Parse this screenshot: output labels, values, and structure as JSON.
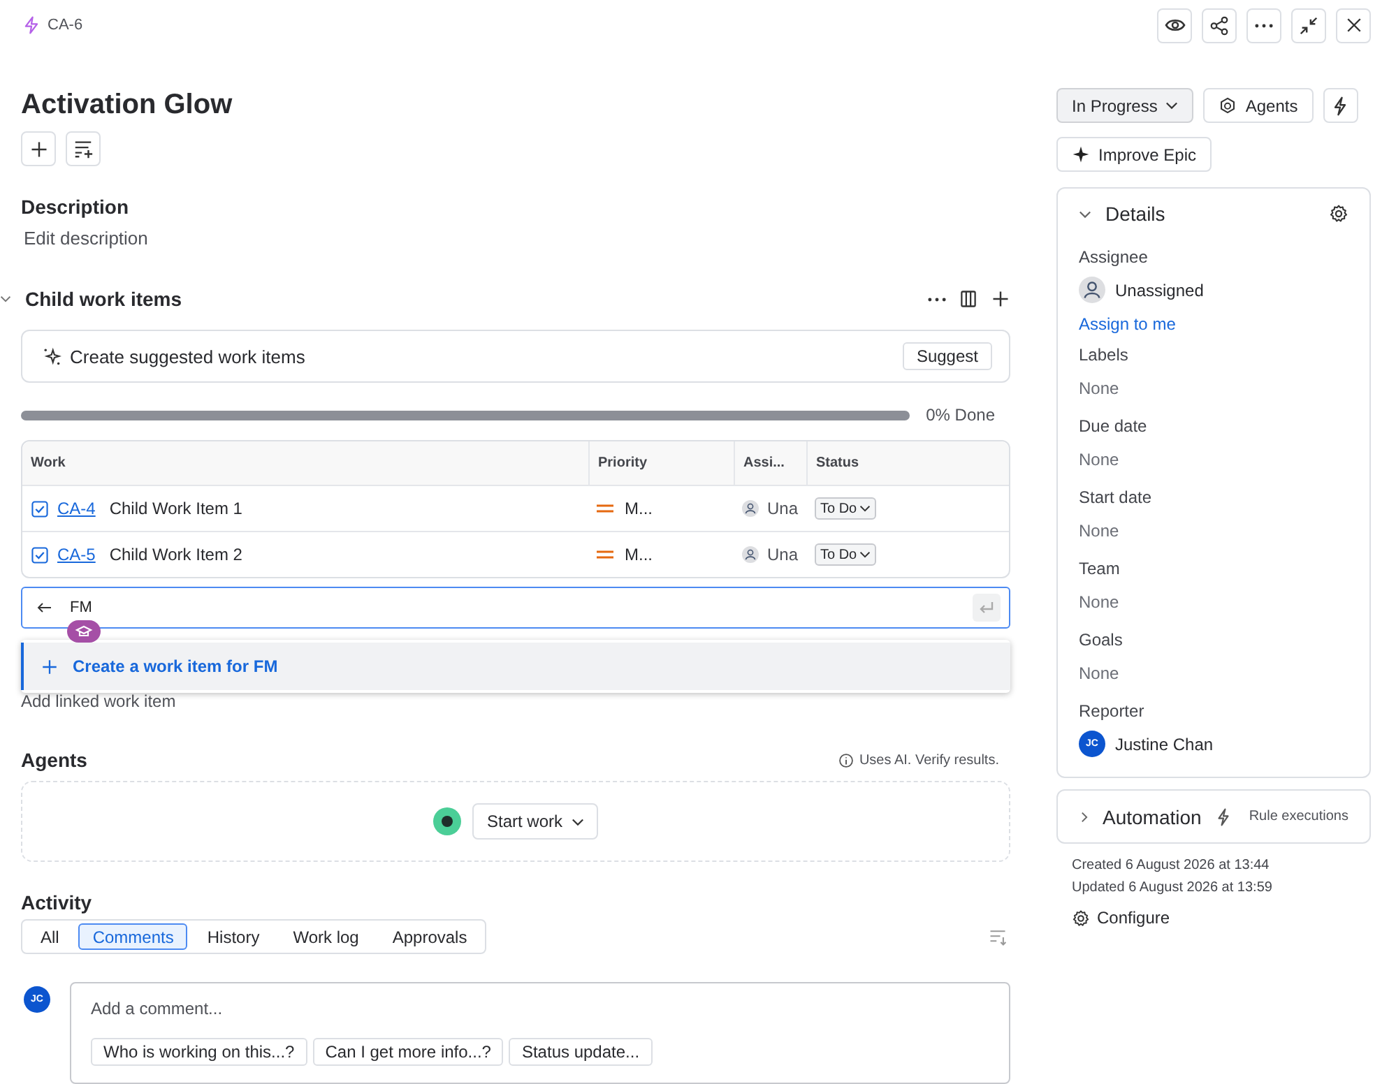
{
  "breadcrumb": "CA-6",
  "title": "Activation Glow",
  "description": {
    "heading": "Description",
    "placeholder": "Edit description"
  },
  "child_items": {
    "heading": "Child work items",
    "expanded": true,
    "suggest_text": "Create suggested work items",
    "suggest_button": "Suggest",
    "progress": {
      "level": 0,
      "reading": "0% Done"
    },
    "columns": [
      "Work",
      "Priority",
      "Assi...",
      "Status"
    ],
    "rows": [
      {
        "key": "CA-4",
        "summary": "Child Work Item 1",
        "priority": "M...",
        "assignee": "Una",
        "status": "To Do"
      },
      {
        "key": "CA-5",
        "summary": "Child Work Item 2",
        "priority": "M...",
        "assignee": "Una",
        "status": "To Do"
      }
    ]
  },
  "create_field": {
    "value": "FM",
    "suggestion": "Create a work item for FM"
  },
  "linked_hint": "Add linked work item",
  "agents": {
    "heading": "Agents",
    "note": "Uses AI. Verify results.",
    "button": "Start work"
  },
  "activity": {
    "heading": "Activity",
    "tabs": [
      {
        "label": "All",
        "selected": false
      },
      {
        "label": "Comments",
        "selected": true
      },
      {
        "label": "History",
        "selected": false
      },
      {
        "label": "Work log",
        "selected": false
      },
      {
        "label": "Approvals",
        "selected": false
      }
    ],
    "avatar": "JC",
    "comment_placeholder": "Add a comment...",
    "suggestions": [
      "Who is working on this...?",
      "Can I get more info...?",
      "Status update..."
    ]
  },
  "status_button": "In Progress",
  "agents_button": "Agents",
  "improve_button": "Improve Epic",
  "details": {
    "heading": "Details",
    "expanded": true,
    "fields": [
      {
        "label": "Assignee",
        "kind": "person",
        "value": "Unassigned",
        "action": "Assign to me"
      },
      {
        "label": "Labels",
        "kind": "text",
        "value": "None"
      },
      {
        "label": "Due date",
        "kind": "text",
        "value": "None"
      },
      {
        "label": "Start date",
        "kind": "text",
        "value": "None"
      },
      {
        "label": "Team",
        "kind": "text",
        "value": "None"
      },
      {
        "label": "Goals",
        "kind": "text",
        "value": "None"
      },
      {
        "label": "Reporter",
        "kind": "person",
        "value": "Justine Chan",
        "initials": "JC"
      }
    ]
  },
  "automation": {
    "heading": "Automation",
    "link": "Rule executions",
    "expanded": false
  },
  "created": "Created 6 August 2026 at 13:44",
  "updated": "Updated 6 August 2026 at 13:59",
  "configure": "Configure"
}
